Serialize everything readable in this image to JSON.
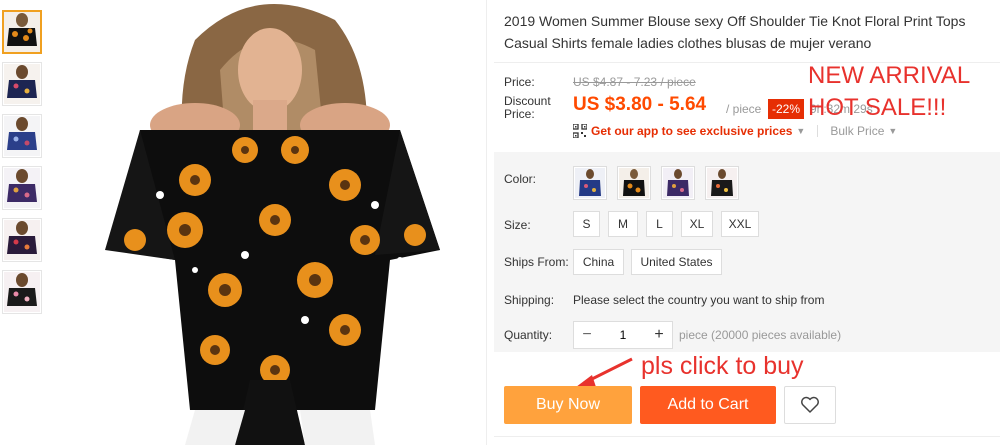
{
  "product": {
    "title": "2019 Women Summer Blouse sexy Off Shoulder Tie Knot Floral Print Tops Casual Shirts female ladies clothes blusas de mujer verano"
  },
  "thumbnails": [
    {
      "icon": "blouse-thumbnail-black-floral",
      "active": true
    },
    {
      "icon": "blouse-thumbnail-navy-floral",
      "active": false
    },
    {
      "icon": "blouse-thumbnail-blue-floral",
      "active": false
    },
    {
      "icon": "blouse-thumbnail-purple-floral",
      "active": false
    },
    {
      "icon": "blouse-thumbnail-red-floral",
      "active": false
    },
    {
      "icon": "blouse-thumbnail-pink-floral",
      "active": false
    }
  ],
  "pricing": {
    "price_label": "Price:",
    "original_price": "US $4.87 - 7.23 / piece",
    "discount_label_1": "Discount",
    "discount_label_2": "Price:",
    "discount_price": "US $3.80 - 5.64",
    "per_piece": "/ piece",
    "discount_badge": "-22%",
    "timer": "9h:32m:29s",
    "app_promo": "Get our app to see exclusive prices",
    "bulk_price": "Bulk Price"
  },
  "overlay_notes": {
    "new_arrival": "NEW ARRIVAL",
    "hot_sale": "HOT SALE!!!",
    "click_to_buy": "pls click to buy"
  },
  "options": {
    "color_label": "Color:",
    "colors": [
      "navy-floral",
      "black-sunflower",
      "purple-floral",
      "black-floral"
    ],
    "size_label": "Size:",
    "sizes": [
      "S",
      "M",
      "L",
      "XL",
      "XXL"
    ],
    "ships_from_label": "Ships From:",
    "ships_from": [
      "China",
      "United States"
    ],
    "shipping_label": "Shipping:",
    "shipping_text": "Please select the country you want to ship from",
    "quantity_label": "Quantity:",
    "quantity_value": "1",
    "quantity_minus": "−",
    "quantity_plus": "+",
    "quantity_note": "piece (20000 pieces available)"
  },
  "actions": {
    "buy_now": "Buy Now",
    "add_to_cart": "Add to Cart"
  },
  "colors": {
    "accent_orange": "#ff4a00",
    "buy_now_bg": "#ffa23d",
    "add_to_cart_bg": "#ff5a1f",
    "badge_red": "#e62e04",
    "note_red": "#e8322d"
  }
}
